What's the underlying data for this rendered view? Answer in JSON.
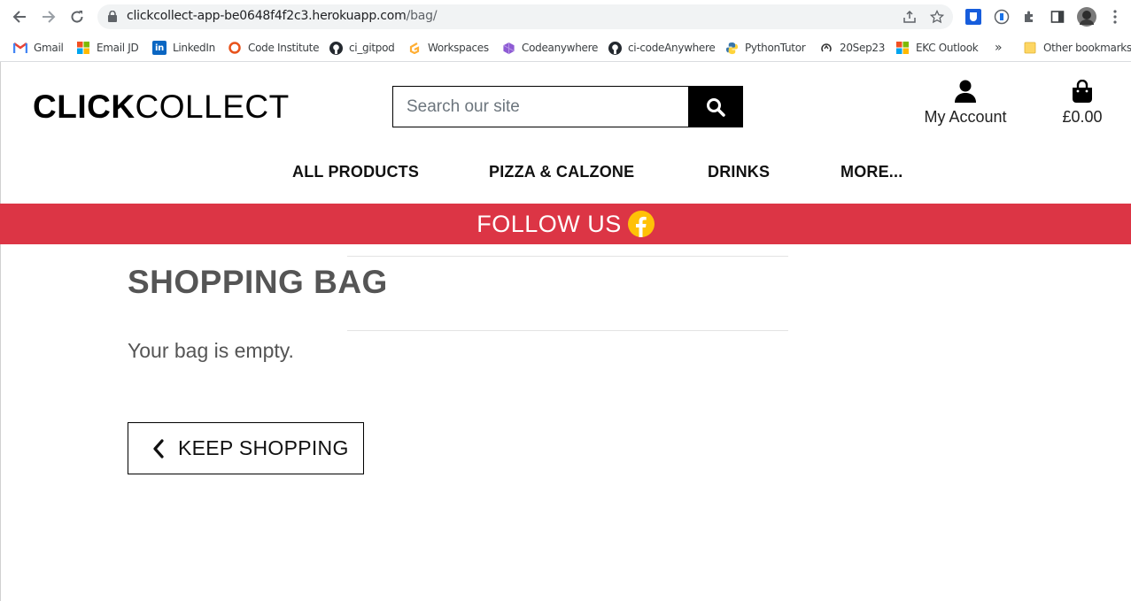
{
  "browser": {
    "url_host": "clickcollect-app-be0648f4f2c3.herokuapp.com",
    "url_path": "/bag/",
    "bookmarks": [
      {
        "label": "Gmail",
        "icon": "gmail-icon"
      },
      {
        "label": "Email JD",
        "icon": "microsoft-icon"
      },
      {
        "label": "LinkedIn",
        "icon": "linkedin-icon"
      },
      {
        "label": "Code Institute",
        "icon": "code-institute-icon"
      },
      {
        "label": "ci_gitpod",
        "icon": "github-icon"
      },
      {
        "label": "Workspaces",
        "icon": "gitpod-icon"
      },
      {
        "label": "Codeanywhere",
        "icon": "codeanywhere-icon"
      },
      {
        "label": "ci-codeAnywhere",
        "icon": "github-icon"
      },
      {
        "label": "PythonTutor",
        "icon": "python-icon"
      },
      {
        "label": "20Sep23",
        "icon": "loop-icon"
      },
      {
        "label": "EKC Outlook",
        "icon": "microsoft-icon"
      }
    ],
    "more_bookmarks": "»",
    "other_bookmarks": "Other bookmarks"
  },
  "header": {
    "logo_bold": "CLICK",
    "logo_thin": "COLLECT",
    "search_placeholder": "Search our site",
    "account_label": "My Account",
    "bag_total": "£0.00"
  },
  "nav": {
    "items": [
      "ALL PRODUCTS",
      "PIZZA & CALZONE",
      "DRINKS",
      "MORE..."
    ]
  },
  "banner": {
    "text": "FOLLOW US"
  },
  "main": {
    "title": "SHOPPING BAG",
    "empty_message": "Your bag is empty.",
    "keep_shopping_label": "KEEP SHOPPING"
  },
  "colors": {
    "banner": "#dc3545",
    "facebook_icon": "#ffc107"
  }
}
